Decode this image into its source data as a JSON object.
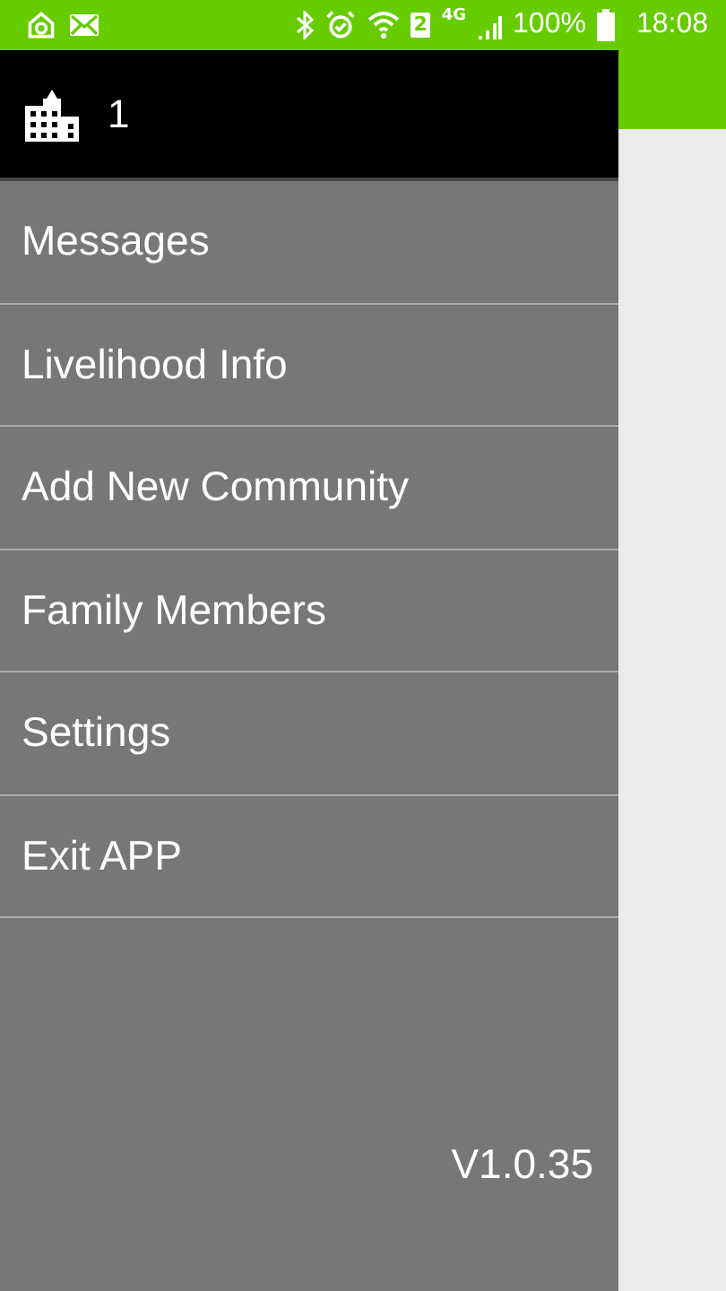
{
  "status_bar": {
    "sim": "2",
    "network": "4G",
    "battery": "100%",
    "time": "18:08"
  },
  "drawer": {
    "header": {
      "count": "1"
    },
    "items": [
      {
        "label": "Messages"
      },
      {
        "label": "Livelihood Info"
      },
      {
        "label": "Add New Community"
      },
      {
        "label": "Family Members"
      },
      {
        "label": "Settings"
      },
      {
        "label": "Exit APP"
      }
    ],
    "version": "V1.0.35"
  }
}
